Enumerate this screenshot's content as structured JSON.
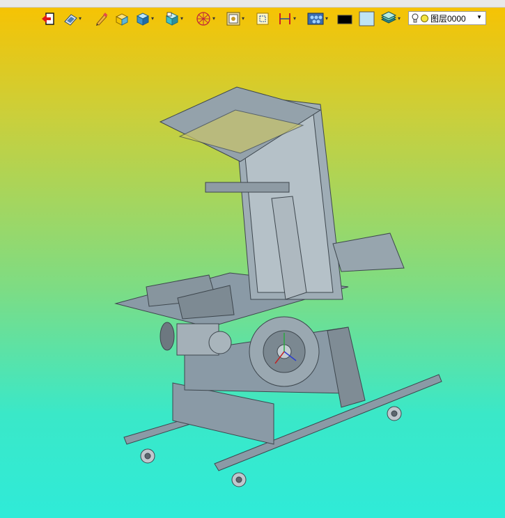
{
  "toolbar": {
    "icons": [
      "exit-icon",
      "open-file-icon",
      "pencil-icon",
      "solid-box-icon",
      "cube-icon",
      "cube-view-icon",
      "wireframe-sphere-icon",
      "select-filter-icon",
      "zoom-window-icon",
      "measure-icon",
      "render-icon",
      "color-icon",
      "background-color-icon",
      "layers-icon"
    ],
    "colors": {
      "line_color": "#000000",
      "background_color": "#bfe4f5"
    },
    "layer": {
      "value": "图层0000"
    }
  },
  "viewport": {
    "gradient_top": "#f9c200",
    "gradient_bottom": "#2febd8",
    "model": "machine-assembly"
  }
}
